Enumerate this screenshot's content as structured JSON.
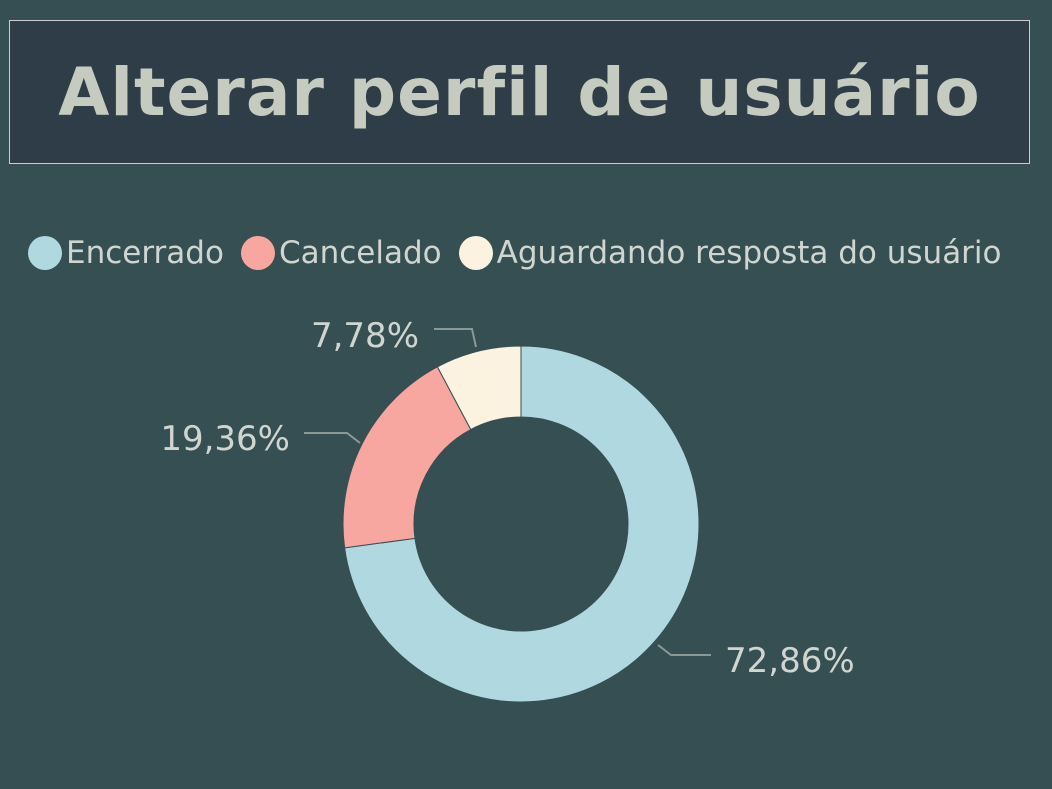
{
  "title": "Alterar perfil de usuário",
  "colors": {
    "background": "#364f52",
    "title_background": "#2f3d48",
    "text": "#d0d6cf",
    "leader": "#8c9896"
  },
  "chart_data": {
    "type": "pie",
    "subtype": "donut",
    "legend_position": "top-left",
    "series": [
      {
        "name": "Encerrado",
        "value": 72.86,
        "label": "72,86%",
        "color": "#b0d8e0"
      },
      {
        "name": "Cancelado",
        "value": 19.36,
        "label": "19,36%",
        "color": "#f7a6a0"
      },
      {
        "name": "Aguardando resposta do usuário",
        "value": 7.78,
        "label": "7,78%",
        "color": "#fbf3e0"
      }
    ]
  }
}
